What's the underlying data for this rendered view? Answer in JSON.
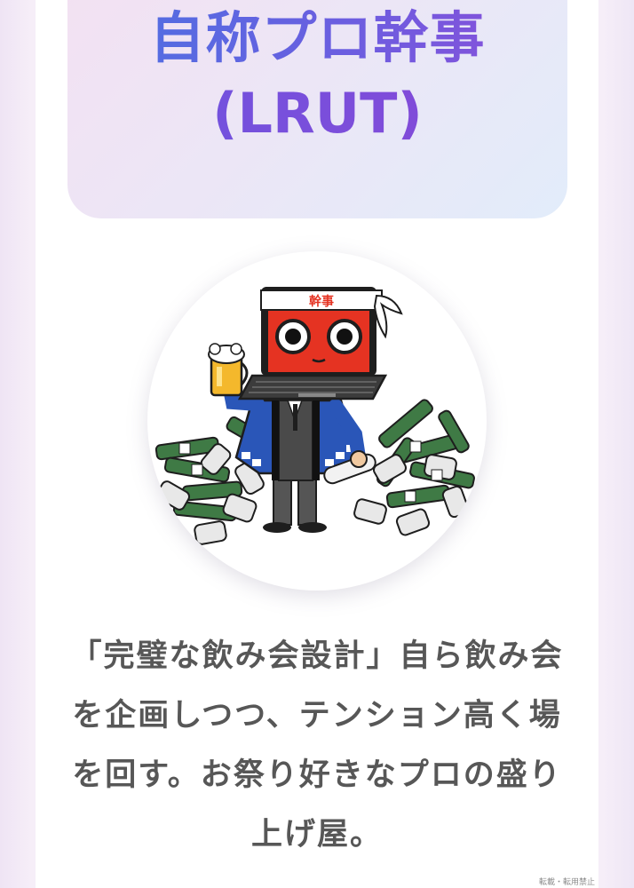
{
  "title": {
    "line1": "自称プロ幹事",
    "line2": "(LRUT)"
  },
  "avatar": {
    "headband_text": "幹事",
    "icon": "laptop-mascot-icon"
  },
  "description": "「完璧な飲み会設計」自ら飲み会を企画しつつ、テンション高く場を回す。お祭り好きなプロの盛り上げ屋。",
  "footer": {
    "watermark": "転載・転用禁止"
  },
  "colors": {
    "title_blue": "#4a72e2",
    "title_purple": "#8b4ed9",
    "text": "#575757",
    "laptop_red": "#e53322",
    "happi_blue": "#2a56b8"
  }
}
